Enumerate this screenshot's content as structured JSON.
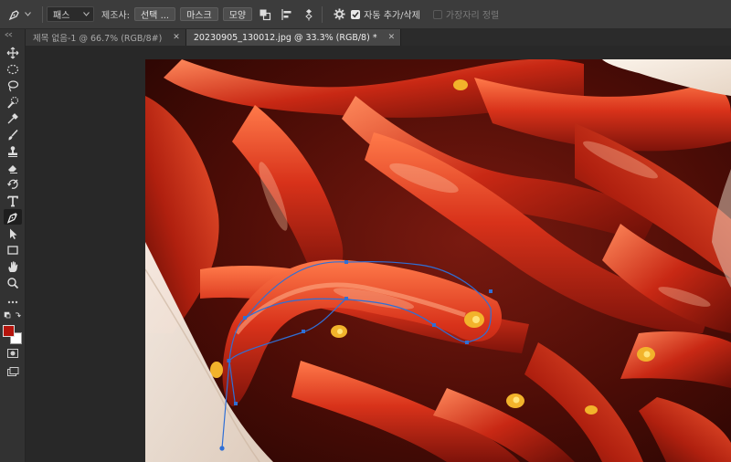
{
  "options": {
    "mode_select": "패스",
    "make_label": "제조사:",
    "btn_selection": "선택 ...",
    "btn_mask": "마스크",
    "btn_shape": "모양",
    "auto_add_delete": "자동 추가/삭제",
    "auto_add_delete_checked": true,
    "align_edges": "가장자리 정렬",
    "align_edges_checked": false
  },
  "tabs": [
    {
      "label": "제목 없음-1 @ 66.7% (RGB/8#)",
      "active": false
    },
    {
      "label": "20230905_130012.jpg @ 33.3% (RGB/8) *",
      "active": true
    }
  ],
  "tools": [
    {
      "name": "move-tool",
      "icon": "move-icon",
      "active": false
    },
    {
      "name": "elliptical-marquee-tool",
      "icon": "ellipse-marquee-icon",
      "active": false
    },
    {
      "name": "lasso-tool",
      "icon": "lasso-icon",
      "active": false
    },
    {
      "name": "quick-selection-tool",
      "icon": "quick-select-icon",
      "active": false
    },
    {
      "name": "eyedropper-tool",
      "icon": "eyedropper-icon",
      "active": false
    },
    {
      "name": "brush-tool",
      "icon": "brush-icon",
      "active": false
    },
    {
      "name": "clone-stamp-tool",
      "icon": "stamp-icon",
      "active": false
    },
    {
      "name": "eraser-tool",
      "icon": "eraser-icon",
      "active": false
    },
    {
      "name": "history-brush-tool",
      "icon": "history-brush-icon",
      "active": false
    },
    {
      "name": "type-tool",
      "icon": "type-icon",
      "active": false
    },
    {
      "name": "pen-tool",
      "icon": "pen-icon",
      "active": true
    },
    {
      "name": "path-selection-tool",
      "icon": "arrow-icon",
      "active": false
    },
    {
      "name": "rectangle-tool",
      "icon": "rectangle-icon",
      "active": false
    },
    {
      "name": "hand-tool",
      "icon": "hand-icon",
      "active": false
    },
    {
      "name": "zoom-tool",
      "icon": "zoom-icon",
      "active": false
    }
  ],
  "colors": {
    "foreground": "#b5140c",
    "background": "#ffffff",
    "ui_dark": "#282828",
    "path_stroke": "#2f6fd6"
  }
}
